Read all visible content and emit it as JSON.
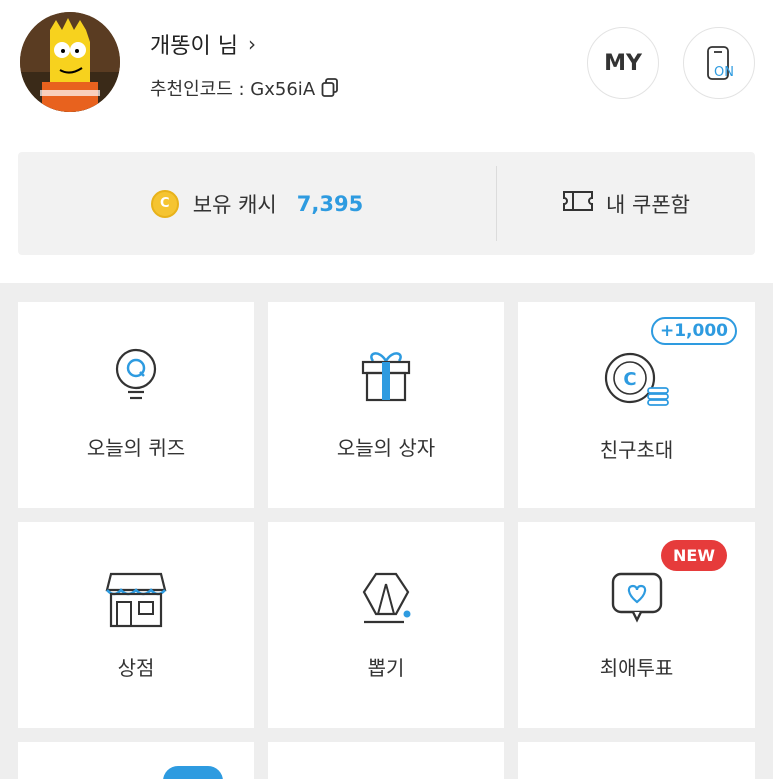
{
  "profile": {
    "name": "개똥이 님",
    "chevron": "›",
    "referral_label": "추천인코드 : Gx56iA",
    "copy_icon": "copy-icon",
    "my_button": "MY",
    "on_button": "ON"
  },
  "cash": {
    "label": "보유 캐시",
    "amount": "7,395",
    "coin_symbol": "C",
    "coupon_label": "내 쿠폰함"
  },
  "tiles": [
    {
      "label": "오늘의 퀴즈",
      "icon": "quiz-bulb-icon"
    },
    {
      "label": "오늘의 상자",
      "icon": "gift-box-icon"
    },
    {
      "label": "친구초대",
      "icon": "coin-stack-icon",
      "badge": "+1,000"
    },
    {
      "label": "상점",
      "icon": "store-icon"
    },
    {
      "label": "뽑기",
      "icon": "gacha-icon"
    },
    {
      "label": "최애투표",
      "icon": "heart-bubble-icon",
      "badge": "NEW"
    }
  ],
  "colors": {
    "accent": "#2e9be0",
    "coin": "#f5c431",
    "new_badge": "#e63b3b",
    "grid_bg": "#eeeeee"
  }
}
